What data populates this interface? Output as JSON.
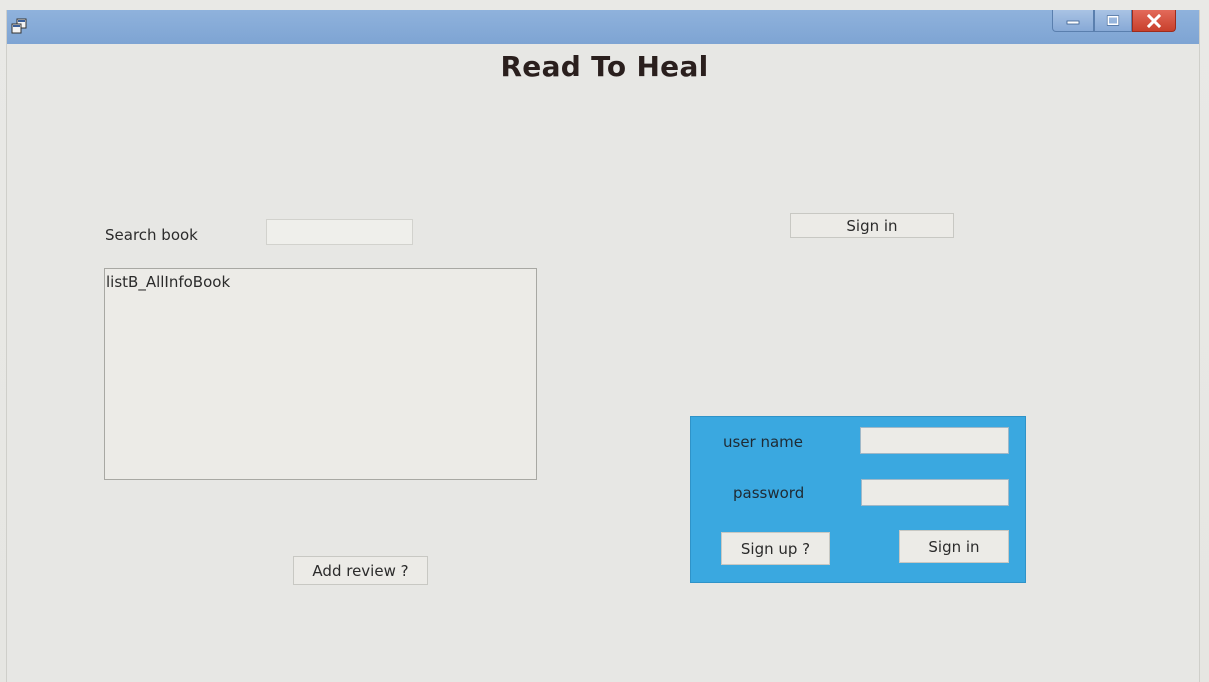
{
  "window": {
    "controls": {
      "minimize_icon": "minimize-icon",
      "maximize_icon": "maximize-icon",
      "close_icon": "close-icon"
    },
    "titlebar_color": "#8fb2dc",
    "close_color": "#d4503c"
  },
  "heading": "Read To Heal",
  "search": {
    "label": "Search book",
    "value": ""
  },
  "top_sign_in_label": "Sign in",
  "book_list": {
    "items": [
      "listB_AllInfoBook"
    ]
  },
  "add_review_label": "Add review ?",
  "login": {
    "panel_color": "#3aa8e0",
    "username_label": "user name",
    "username_value": "",
    "password_label": "password",
    "password_value": "",
    "sign_up_label": "Sign up ?",
    "sign_in_label": "Sign in"
  }
}
